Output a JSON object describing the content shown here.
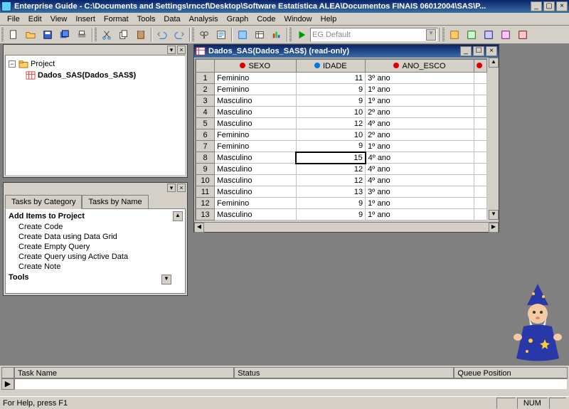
{
  "app": {
    "icon": "eg-app-icon",
    "title": "Enterprise Guide - C:\\Documents and Settings\\rnccf\\Desktop\\Software Estatística ALEA\\Documentos FINAIS 06012004\\SAS\\P..."
  },
  "menubar": [
    "File",
    "Edit",
    "View",
    "Insert",
    "Format",
    "Tools",
    "Data",
    "Analysis",
    "Graph",
    "Code",
    "Window",
    "Help"
  ],
  "toolbar_combo": {
    "icon": "run-icon",
    "value": "EG Default"
  },
  "project_tree": {
    "root": {
      "label": "Project",
      "expanded": true
    },
    "child": {
      "label": "Dados_SAS(Dados_SAS$)",
      "selected": true
    }
  },
  "task_tabs": {
    "active": "Tasks by Category",
    "other": "Tasks by Name"
  },
  "task_panel": {
    "header": "Add Items to Project",
    "items": [
      "Create Code",
      "Create Data using Data Grid",
      "Create Empty Query",
      "Create Query using Active Data",
      "Create Note"
    ],
    "header2": "Tools"
  },
  "data_window": {
    "title": "Dados_SAS(Dados_SAS$) (read-only)",
    "columns": [
      {
        "name": "SEXO",
        "icon": "red"
      },
      {
        "name": "IDADE",
        "icon": "blue"
      },
      {
        "name": "ANO_ESCO",
        "icon": "red"
      }
    ],
    "selected_cell": {
      "row": 8,
      "col": "IDADE"
    },
    "rows": [
      {
        "n": 1,
        "SEXO": "Feminino",
        "IDADE": 11,
        "ANO_ESCO": "3º ano"
      },
      {
        "n": 2,
        "SEXO": "Feminino",
        "IDADE": 9,
        "ANO_ESCO": "1º ano"
      },
      {
        "n": 3,
        "SEXO": "Masculino",
        "IDADE": 9,
        "ANO_ESCO": "1º ano"
      },
      {
        "n": 4,
        "SEXO": "Masculino",
        "IDADE": 10,
        "ANO_ESCO": "2º ano"
      },
      {
        "n": 5,
        "SEXO": "Masculino",
        "IDADE": 12,
        "ANO_ESCO": "4º ano"
      },
      {
        "n": 6,
        "SEXO": "Feminino",
        "IDADE": 10,
        "ANO_ESCO": "2º ano"
      },
      {
        "n": 7,
        "SEXO": "Feminino",
        "IDADE": 9,
        "ANO_ESCO": "1º ano"
      },
      {
        "n": 8,
        "SEXO": "Masculino",
        "IDADE": 15,
        "ANO_ESCO": "4º ano"
      },
      {
        "n": 9,
        "SEXO": "Masculino",
        "IDADE": 12,
        "ANO_ESCO": "4º ano"
      },
      {
        "n": 10,
        "SEXO": "Masculino",
        "IDADE": 12,
        "ANO_ESCO": "4º ano"
      },
      {
        "n": 11,
        "SEXO": "Masculino",
        "IDADE": 13,
        "ANO_ESCO": "3º ano"
      },
      {
        "n": 12,
        "SEXO": "Feminino",
        "IDADE": 9,
        "ANO_ESCO": "1º ano"
      },
      {
        "n": 13,
        "SEXO": "Masculino",
        "IDADE": 9,
        "ANO_ESCO": "1º ano"
      }
    ]
  },
  "task_status": {
    "columns": [
      "Task Name",
      "Status",
      "Queue Position"
    ]
  },
  "statusbar": {
    "help": "For Help, press F1",
    "num": "NUM"
  }
}
